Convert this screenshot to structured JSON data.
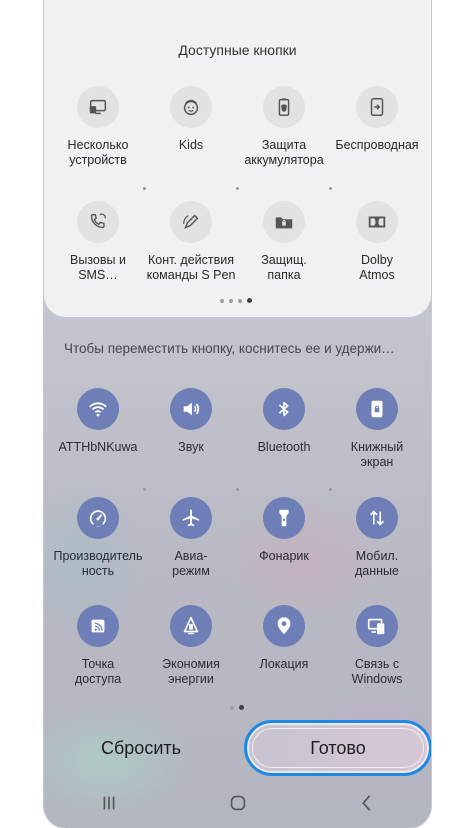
{
  "available": {
    "title": "Доступные кнопки",
    "tiles": [
      {
        "label": "Несколько\nустройств",
        "icon": "multi-device-icon"
      },
      {
        "label": "Kids",
        "icon": "kids-icon"
      },
      {
        "label": "Защита\nаккумулятора",
        "icon": "battery-protect-icon"
      },
      {
        "label": "Беспроводная",
        "icon": "wireless-share-icon"
      },
      {
        "label": "Вызовы и SMS…",
        "icon": "calls-sms-icon"
      },
      {
        "label": "Конт. действия\nкоманды S Pen",
        "icon": "s-pen-icon"
      },
      {
        "label": "Защищ.\nпапка",
        "icon": "secure-folder-icon"
      },
      {
        "label": "Dolby\nAtmos",
        "icon": "dolby-icon"
      }
    ],
    "pager": {
      "pages": 4,
      "active": 3
    }
  },
  "hint": "Чтобы переместить кнопку, коснитесь ее и удержи…",
  "active_tiles": [
    {
      "label": "ATTHbNKuwa",
      "icon": "wifi-icon"
    },
    {
      "label": "Звук",
      "icon": "sound-icon"
    },
    {
      "label": "Bluetooth",
      "icon": "bluetooth-icon"
    },
    {
      "label": "Книжный\nэкран",
      "icon": "portrait-lock-icon"
    },
    {
      "label": "Производитель\nность",
      "icon": "performance-icon"
    },
    {
      "label": "Авиа-\nрежим",
      "icon": "airplane-icon"
    },
    {
      "label": "Фонарик",
      "icon": "flashlight-icon"
    },
    {
      "label": "Мобил.\nданные",
      "icon": "mobile-data-icon"
    },
    {
      "label": "Точка\nдоступа",
      "icon": "hotspot-icon"
    },
    {
      "label": "Экономия\nэнергии",
      "icon": "power-saving-icon"
    },
    {
      "label": "Локация",
      "icon": "location-icon"
    },
    {
      "label": "Связь с\nWindows",
      "icon": "link-windows-icon"
    }
  ],
  "active_pager": {
    "pages": 2,
    "active": 1
  },
  "buttons": {
    "reset": "Сбросить",
    "done": "Готово"
  },
  "navbar": [
    "recents-icon",
    "home-icon",
    "back-icon"
  ],
  "colors": {
    "accent_ring": "#1e88e5",
    "active_icon_bg": "#6d7fb6",
    "available_icon_bg": "#e2e2e6"
  }
}
